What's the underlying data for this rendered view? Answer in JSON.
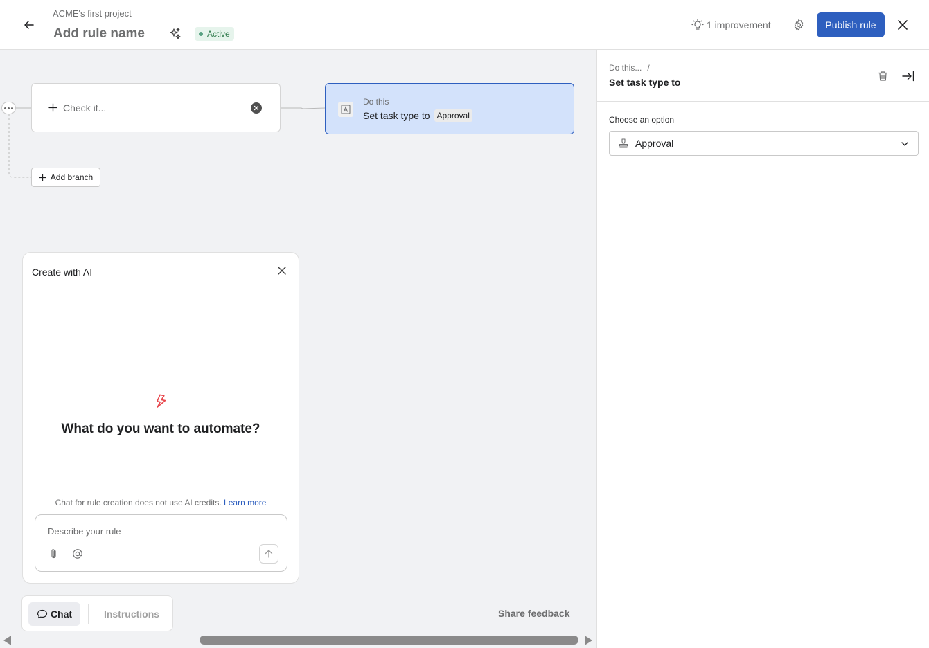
{
  "header": {
    "project_name": "ACME's first project",
    "rule_name_placeholder": "Add rule name",
    "status": "Active",
    "improvement": "1 improvement",
    "publish_label": "Publish rule"
  },
  "canvas": {
    "trigger": {
      "placeholder": "Check if..."
    },
    "action": {
      "title": "Do this",
      "text": "Set task type to",
      "value": "Approval"
    },
    "add_branch_label": "Add branch"
  },
  "ai_panel": {
    "title": "Create with AI",
    "heading": "What do you want to automate?",
    "note": "Chat for rule creation does not use AI credits.",
    "learn_more": "Learn more",
    "input_placeholder": "Describe your rule"
  },
  "bottom_tabs": {
    "chat": "Chat",
    "instructions": "Instructions",
    "share_feedback": "Share feedback"
  },
  "right_panel": {
    "breadcrumb_parent": "Do this...",
    "breadcrumb_sep": "/",
    "title": "Set task type to",
    "field_label": "Choose an option",
    "selected_option": "Approval"
  },
  "colors": {
    "accent": "#2e5fbf",
    "action_card_bg": "#d3e2fb",
    "status_green": "#58a182",
    "bolt_red": "#e8474d"
  },
  "icons": {
    "back": "arrow-left-icon",
    "sparkle": "sparkle-icon",
    "improvement": "lightbulb-icon",
    "settings": "gear-icon",
    "close": "close-icon",
    "trash": "trash-icon",
    "collapse": "collapse-right-icon",
    "option": "stamp-icon",
    "bolt": "lightning-bolt-icon"
  }
}
